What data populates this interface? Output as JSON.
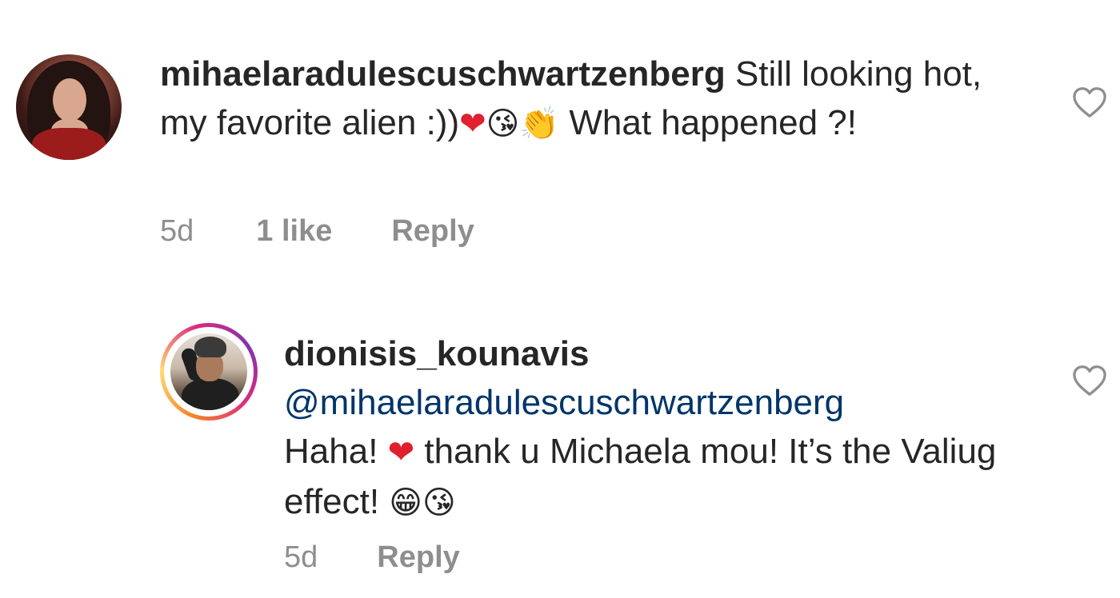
{
  "comments": [
    {
      "username": "mihaelaradulescuschwartzenberg",
      "text_before_emojis": " Still looking hot, my favorite alien :))",
      "emojis": [
        "❤",
        "😘",
        "👏"
      ],
      "text_after_emojis": " What happened ?!",
      "time": "5d",
      "likes": "1 like",
      "reply_label": "Reply",
      "like_icon": "heart-outline-icon",
      "avatar_ring": false
    },
    {
      "username": "dionisis_kounavis",
      "mention": "@mihaelaradulescuschwartzenberg",
      "text_part_1": "Haha! ",
      "emoji_1": "❤",
      "text_part_2": " thank u Michaela mou! It’s the Valiug effect! ",
      "emojis_end": [
        "😁",
        "😘"
      ],
      "time": "5d",
      "reply_label": "Reply",
      "like_icon": "heart-outline-icon",
      "avatar_ring": true
    }
  ],
  "colors": {
    "text": "#262626",
    "meta": "#8e8e8e",
    "mention": "#003569",
    "heart_emoji": "#e0202e",
    "story_ring": [
      "#f58529",
      "#feda77",
      "#dd2a7b",
      "#8134af"
    ]
  }
}
